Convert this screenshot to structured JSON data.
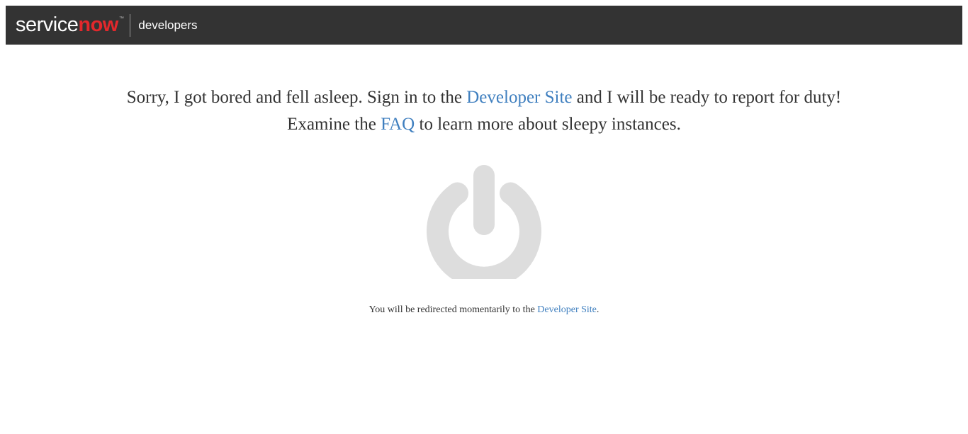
{
  "header": {
    "brand_service": "service",
    "brand_now": "now",
    "brand_tm": "™",
    "section_label": "developers"
  },
  "message": {
    "line1_before": "Sorry, I got bored and fell asleep. Sign in to the ",
    "line1_link": "Developer Site",
    "line1_after": " and I will be ready to report for duty!",
    "line2_before": "Examine the ",
    "line2_link": "FAQ",
    "line2_after": " to learn more about sleepy instances."
  },
  "power_icon": {
    "name": "power-icon",
    "color": "#dddddd"
  },
  "redirect": {
    "before": "You will be redirected momentarily to the ",
    "link": "Developer Site",
    "after": "."
  },
  "colors": {
    "header_bg": "#333333",
    "brand_accent": "#e2282c",
    "link": "#3f7fbf",
    "text": "#333333"
  }
}
